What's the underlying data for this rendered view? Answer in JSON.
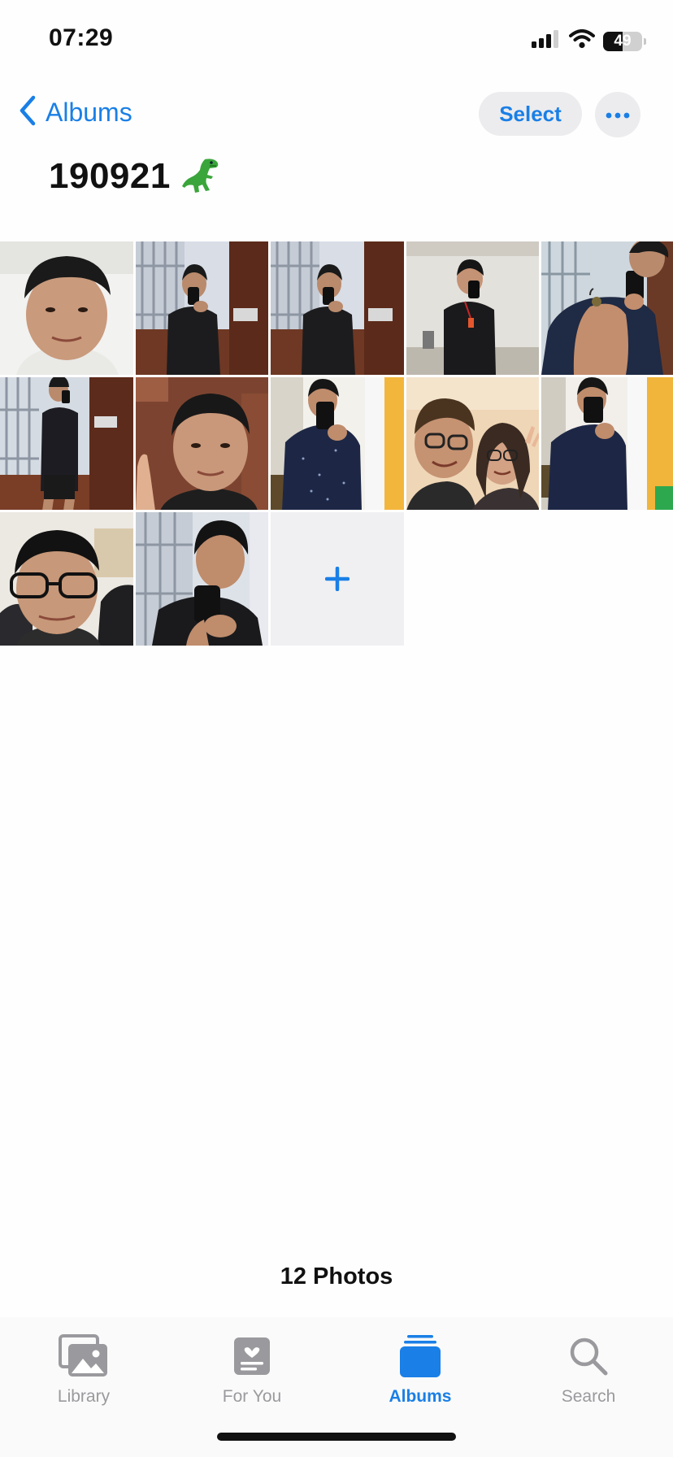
{
  "status_bar": {
    "time": "07:29",
    "battery_level": "49",
    "icons": [
      "cellular-signal-icon",
      "wifi-icon",
      "battery-icon"
    ]
  },
  "nav": {
    "back_label": "Albums",
    "select_label": "Select",
    "more_icon": "ellipsis-icon"
  },
  "album": {
    "title": "190921",
    "title_emoji_icon": "t-rex-emoji-icon"
  },
  "photos": [
    {
      "name": "photo-1",
      "description_icon": "selfie-smiling-face"
    },
    {
      "name": "photo-2",
      "description_icon": "mirror-selfie-doorway"
    },
    {
      "name": "photo-3",
      "description_icon": "mirror-selfie-doorway"
    },
    {
      "name": "photo-4",
      "description_icon": "mirror-selfie-hallway"
    },
    {
      "name": "photo-5",
      "description_icon": "mirror-selfie-shoulder"
    },
    {
      "name": "photo-6",
      "description_icon": "mirror-selfie-full-body"
    },
    {
      "name": "photo-7",
      "description_icon": "selfie-thumbs-up"
    },
    {
      "name": "photo-8",
      "description_icon": "mirror-selfie-window"
    },
    {
      "name": "photo-9",
      "description_icon": "couple-selfie"
    },
    {
      "name": "photo-10",
      "description_icon": "mirror-selfie-window"
    },
    {
      "name": "photo-11",
      "description_icon": "selfie-glasses"
    },
    {
      "name": "photo-12",
      "description_icon": "mirror-selfie-closeup"
    }
  ],
  "add_tile_icon": "plus-icon",
  "footer": {
    "photo_count": "12 Photos"
  },
  "tab_bar": {
    "tabs": [
      {
        "label": "Library",
        "icon": "photo-library-icon",
        "active": false
      },
      {
        "label": "For You",
        "icon": "for-you-icon",
        "active": false
      },
      {
        "label": "Albums",
        "icon": "albums-icon",
        "active": true
      },
      {
        "label": "Search",
        "icon": "search-icon",
        "active": false
      }
    ]
  },
  "colors": {
    "accent": "#1a7fe6",
    "inactive_tab": "#9a9a9e",
    "button_bg": "#ececee"
  }
}
